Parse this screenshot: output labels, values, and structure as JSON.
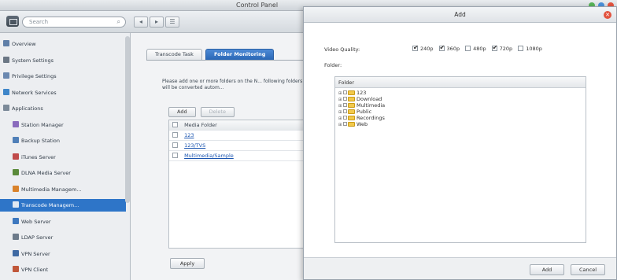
{
  "window": {
    "title": "Control Panel"
  },
  "toolbar": {
    "search_placeholder": "Search"
  },
  "sidebar": {
    "items": [
      {
        "label": "Overview",
        "icon": "overview-icon",
        "level": "top"
      },
      {
        "label": "System Settings",
        "icon": "gear-icon",
        "level": "top"
      },
      {
        "label": "Privilege Settings",
        "icon": "user-icon",
        "level": "top"
      },
      {
        "label": "Network Services",
        "icon": "globe-icon",
        "level": "top"
      },
      {
        "label": "Applications",
        "icon": "applications-icon",
        "level": "top"
      },
      {
        "label": "Station Manager",
        "icon": "station-manager-icon",
        "level": "sub"
      },
      {
        "label": "Backup Station",
        "icon": "backup-icon",
        "level": "sub"
      },
      {
        "label": "iTunes Server",
        "icon": "itunes-icon",
        "level": "sub"
      },
      {
        "label": "DLNA Media Server",
        "icon": "dlna-icon",
        "level": "sub"
      },
      {
        "label": "Multimedia Managem...",
        "icon": "multimedia-icon",
        "level": "sub"
      },
      {
        "label": "Transcode Managem...",
        "icon": "transcode-icon",
        "level": "sub",
        "active": true
      },
      {
        "label": "Web Server",
        "icon": "web-server-icon",
        "level": "sub"
      },
      {
        "label": "LDAP Server",
        "icon": "ldap-icon",
        "level": "sub"
      },
      {
        "label": "VPN Server",
        "icon": "vpn-server-icon",
        "level": "sub"
      },
      {
        "label": "VPN Client",
        "icon": "vpn-client-icon",
        "level": "sub"
      }
    ]
  },
  "content": {
    "tabs": [
      {
        "label": "Transcode Task",
        "active": false
      },
      {
        "label": "Folder Monitoring",
        "active": true
      }
    ],
    "description": "Please add one or more folders on the N... following folders will be converted autom...",
    "add_button": "Add",
    "delete_button": "Delete",
    "table_header": "Media Folder",
    "folders": [
      "123",
      "123/TVS",
      "Multimedia/Sample"
    ],
    "apply_button": "Apply"
  },
  "modal": {
    "title": "Add",
    "video_quality_label": "Video Quality:",
    "quality_options": [
      {
        "label": "240p",
        "checked": true
      },
      {
        "label": "360p",
        "checked": true
      },
      {
        "label": "480p",
        "checked": false
      },
      {
        "label": "720p",
        "checked": true
      },
      {
        "label": "1080p",
        "checked": false
      }
    ],
    "folder_label": "Folder:",
    "tree_header": "Folder",
    "tree_items": [
      "123",
      "Download",
      "Multimedia",
      "Public",
      "Recordings",
      "Web"
    ],
    "add_button": "Add",
    "cancel_button": "Cancel"
  },
  "colors": {
    "accent": "#2e75c8",
    "tab_active": "#3a78c9",
    "close": "#e2533f",
    "folder": "#f2c94c"
  }
}
